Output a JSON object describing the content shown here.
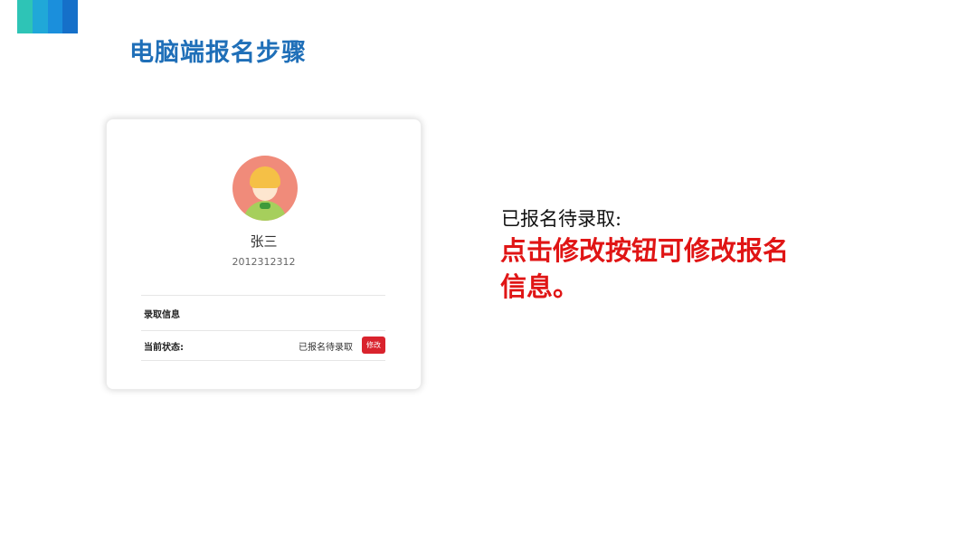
{
  "slide": {
    "title": "电脑端报名步骤"
  },
  "profile": {
    "name": "张三",
    "id": "2012312312",
    "section_label": "录取信息",
    "status_label": "当前状态:",
    "status_value": "已报名待录取",
    "edit_label": "修改"
  },
  "note": {
    "line1": "已报名待录取:",
    "highlight": "点击修改按钮可修改报名信息。"
  },
  "colors": {
    "title": "#1f6fb8",
    "highlight": "#e01515",
    "button": "#d9232d"
  },
  "icons": {
    "avatar": "child-avatar-icon"
  }
}
